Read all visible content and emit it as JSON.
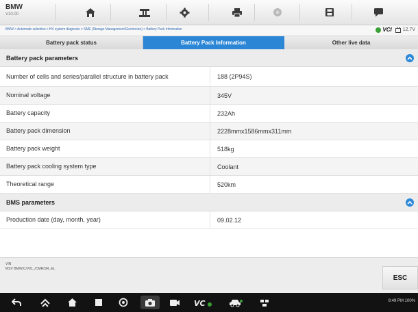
{
  "header": {
    "make": "BMW",
    "version": "V10.00"
  },
  "toolbar": {
    "icons": [
      "home-icon",
      "vehicle-swap-icon",
      "settings-icon",
      "print-icon",
      "help-icon",
      "save-icon",
      "message-icon"
    ]
  },
  "breadcrumb": "BMW > Automatic selection > HV system diagnosis > SME (Storage Management Electronics) > Battery Pack Information",
  "connection": {
    "vci_label": "VCI",
    "battery_label": "12.7V"
  },
  "tabs": [
    {
      "label": "Battery pack status",
      "active": false
    },
    {
      "label": "Battery Pack Information",
      "active": true
    },
    {
      "label": "Other live data",
      "active": false
    }
  ],
  "sections": [
    {
      "title": "Battery pack parameters",
      "rows": [
        {
          "key": "Number of cells and series/parallel structure in battery pack",
          "value": "188 (2P94S)"
        },
        {
          "key": "Nominal voltage",
          "value": "345V"
        },
        {
          "key": "Battery capacity",
          "value": "232Ah"
        },
        {
          "key": "Battery pack dimension",
          "value": "2228mmx1586mmx311mm"
        },
        {
          "key": "Battery pack weight",
          "value": "518kg"
        },
        {
          "key": "Battery pack cooling system type",
          "value": "Coolant"
        },
        {
          "key": "Theoretical range",
          "value": "520km"
        }
      ]
    },
    {
      "title": "BMS parameters",
      "rows": [
        {
          "key": "Production date (day, month, year)",
          "value": "09.02.12"
        }
      ]
    }
  ],
  "footer": {
    "vin_label": "VIN",
    "vin_path": "MSV BMW/C/V01_/CMR/SR_EL",
    "esc_label": "ESC"
  },
  "navbar": {
    "status_text": "8:49 PM 100%"
  },
  "colors": {
    "accent": "#2b86d6",
    "vci_green": "#3aa035",
    "navbar": "#121212"
  }
}
